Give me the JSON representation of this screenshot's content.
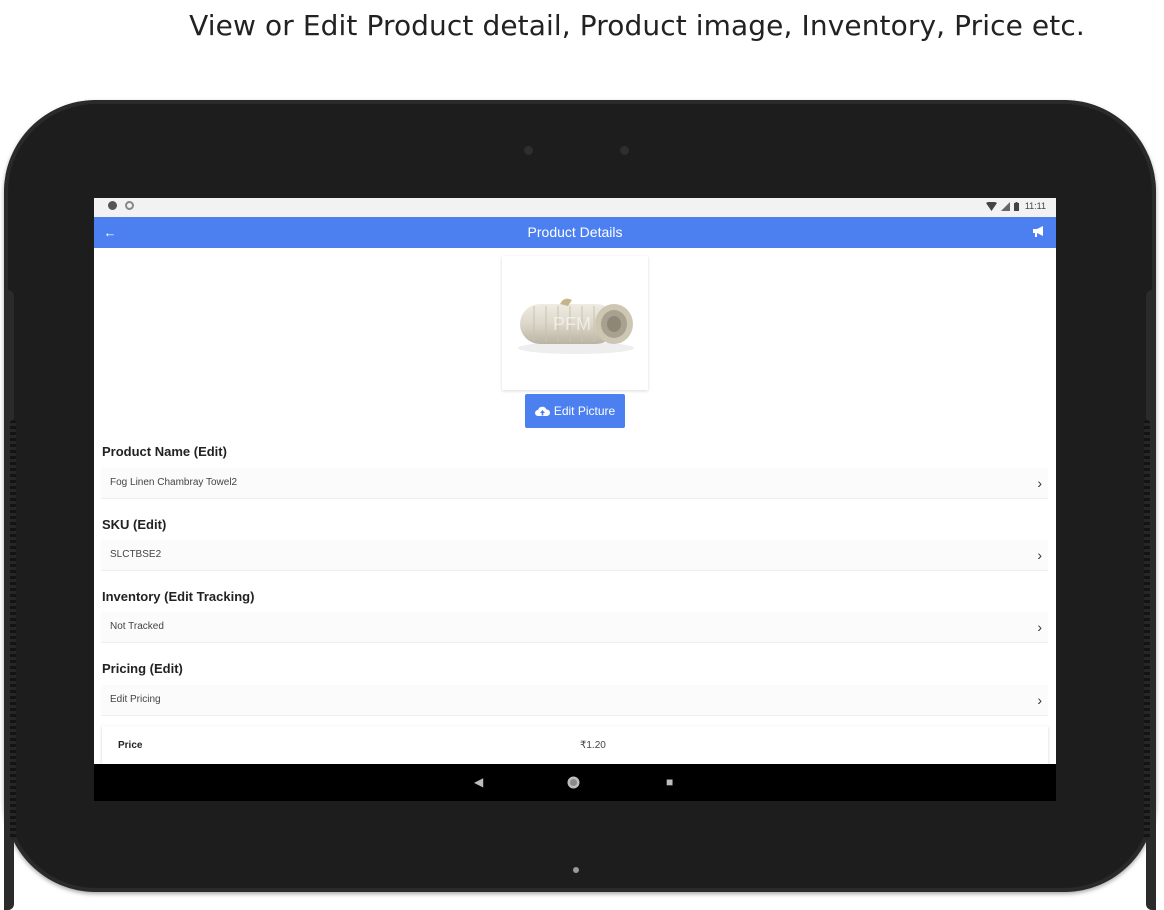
{
  "caption": "View or Edit Product detail, Product image, Inventory, Price  etc.",
  "status_bar": {
    "time": "11:11",
    "left_icons": [
      "settings-icon",
      "sync-icon"
    ],
    "right_icons": [
      "wifi-icon",
      "signal-icon",
      "battery-icon"
    ]
  },
  "app_bar": {
    "title": "Product Details",
    "back_icon": "arrow-left-icon",
    "action_icon": "megaphone-icon",
    "color": "#4c80f1"
  },
  "product_image": {
    "watermark": "PFM"
  },
  "edit_picture_button": {
    "label": "Edit Picture",
    "icon": "cloud-upload-icon"
  },
  "sections": [
    {
      "label": "Product Name (Edit)",
      "value": "Fog Linen Chambray Towel2"
    },
    {
      "label": "SKU (Edit)",
      "value": "SLCTBSE2"
    },
    {
      "label": "Inventory (Edit Tracking)",
      "value": "Not Tracked"
    },
    {
      "label": "Pricing (Edit)",
      "value": "Edit Pricing"
    }
  ],
  "price_row": {
    "label": "Price",
    "amount": "₹1.20"
  },
  "nav_bar": {
    "back_icon": "nav-back-icon",
    "home_icon": "nav-home-icon",
    "recents_icon": "nav-recents-icon"
  }
}
